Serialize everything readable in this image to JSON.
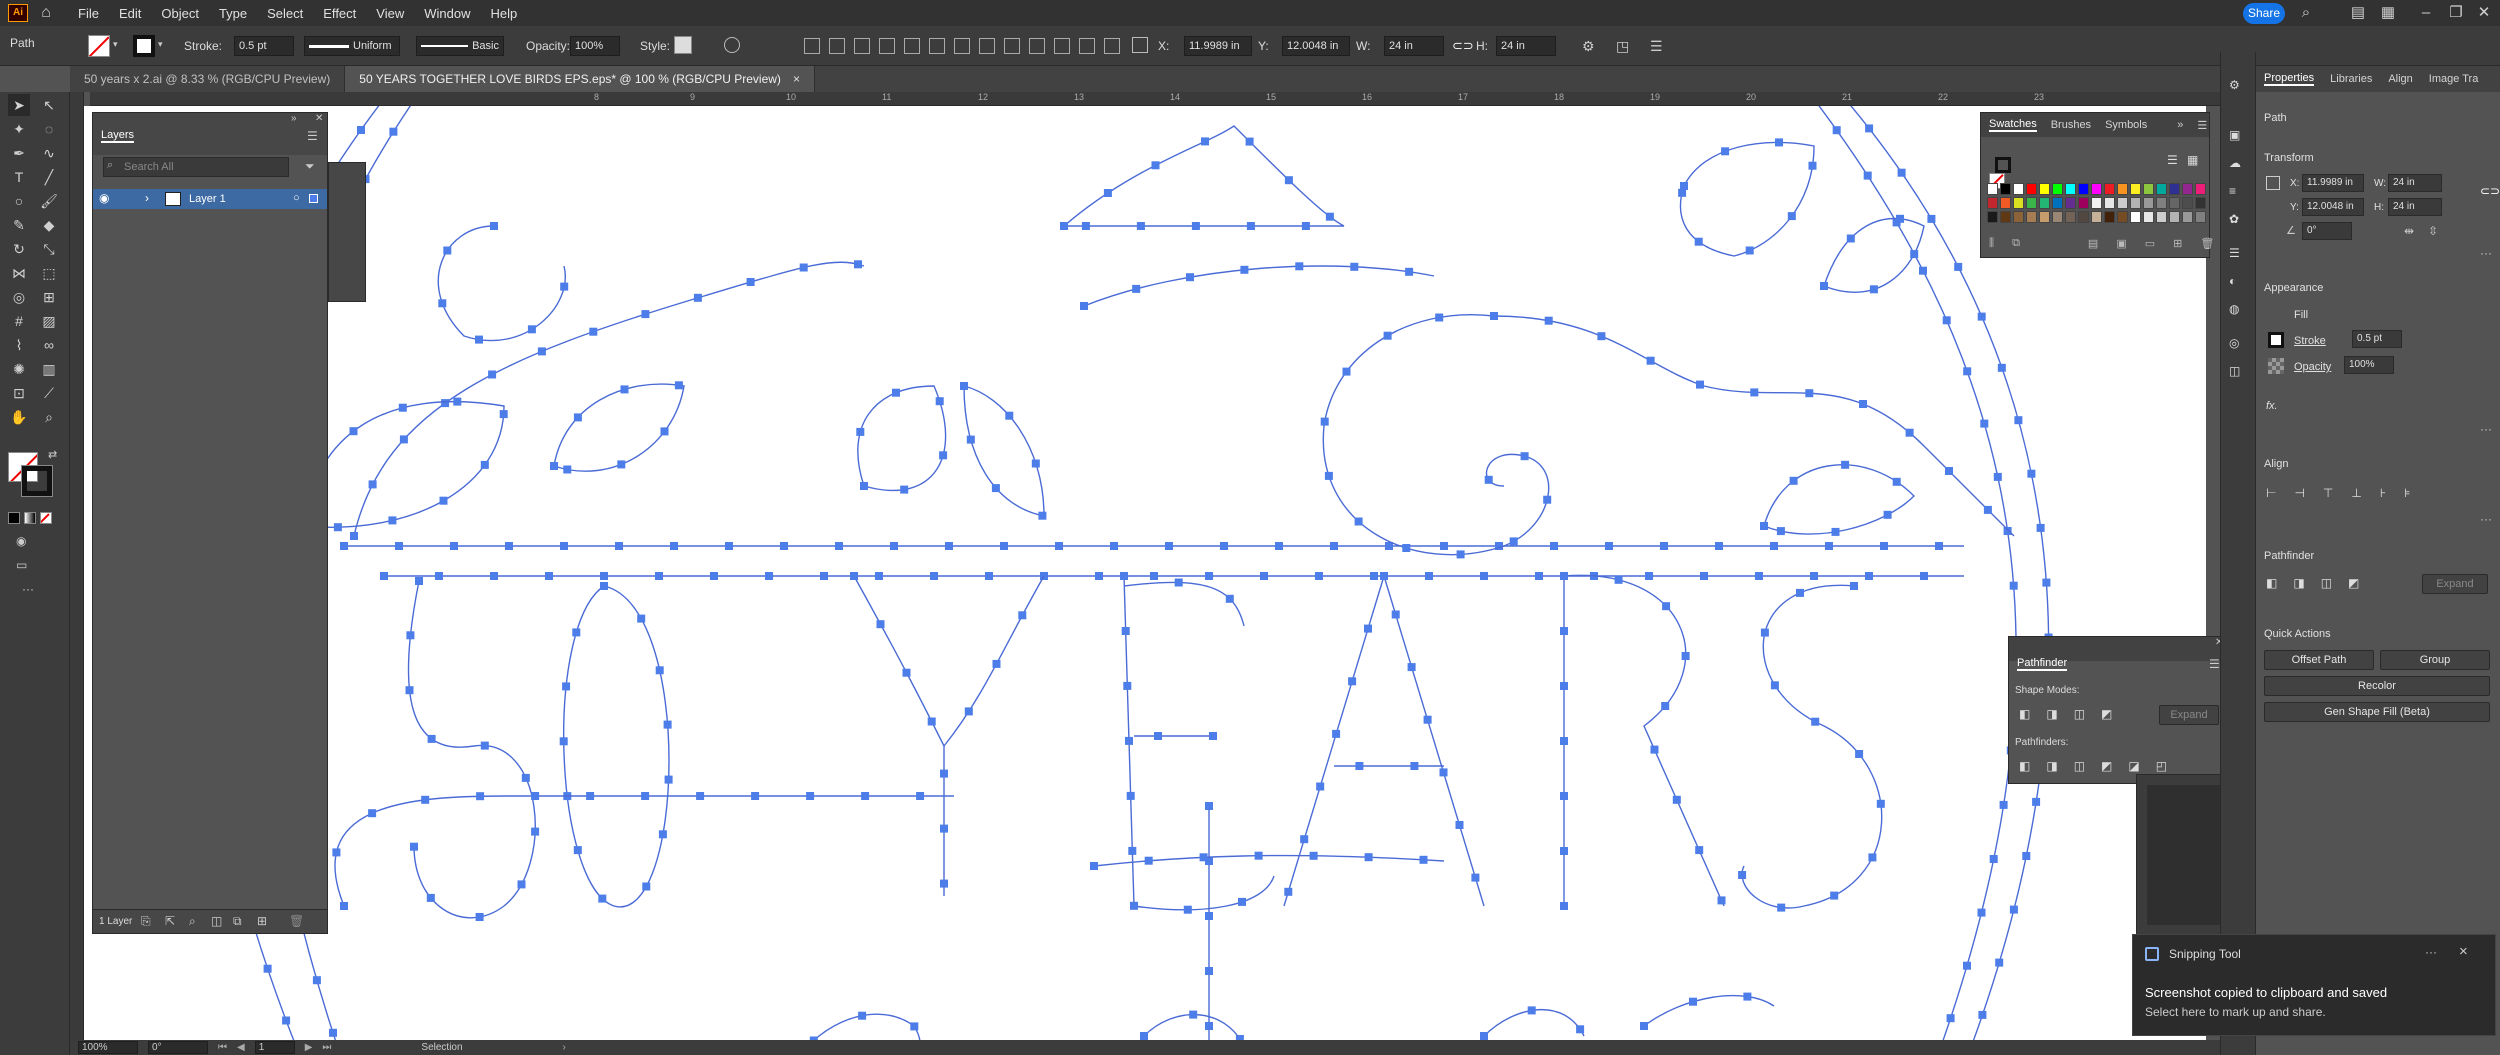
{
  "menubar": {
    "logo": "Ai",
    "menus": [
      "File",
      "Edit",
      "Object",
      "Type",
      "Select",
      "Effect",
      "View",
      "Window",
      "Help"
    ],
    "share_label": "Share"
  },
  "control": {
    "selection_type": "Path",
    "stroke_label": "Stroke:",
    "stroke_value": "0.5 pt",
    "uniform_label": "Uniform",
    "basic_label": "Basic",
    "opacity_label": "Opacity:",
    "opacity_value": "100%",
    "style_label": "Style:",
    "x_label": "X:",
    "x_value": "11.9989 in",
    "y_label": "Y:",
    "y_value": "12.0048 in",
    "w_label": "W:",
    "w_value": "24 in",
    "h_label": "H:",
    "h_value": "24 in"
  },
  "tabs": [
    {
      "label": "50 years x 2.ai @ 8.33 % (RGB/CPU Preview)"
    },
    {
      "label": "50 YEARS TOGETHER LOVE BIRDS EPS.eps* @ 100 % (RGB/CPU Preview)",
      "close": "×"
    }
  ],
  "ruler": {
    "ticks": [
      "8",
      "9",
      "10",
      "11",
      "12",
      "13",
      "14",
      "15",
      "16",
      "17",
      "18",
      "19",
      "20",
      "21",
      "22",
      "23"
    ]
  },
  "layers": {
    "title": "Layers",
    "search_placeholder": "Search All",
    "layer_name": "Layer 1",
    "footer": "1 Layer"
  },
  "swatches": {
    "tabs": [
      "Swatches",
      "Brushes",
      "Symbols"
    ],
    "colors": [
      "#ffffff",
      "#000000",
      "#ffffff",
      "#ff0000",
      "#ffff00",
      "#00ff00",
      "#00ffff",
      "#0000ff",
      "#ff00ff",
      "#ed1c24",
      "#f7931e",
      "#fcee21",
      "#8cc63f",
      "#00a99d",
      "#2e3192",
      "#93278f",
      "#ed1e79",
      "#c1272d",
      "#f15a24",
      "#d9e021",
      "#39b54a",
      "#22b573",
      "#0071bc",
      "#662d91",
      "#9e005d",
      "#f2f2f2",
      "#e6e6e6",
      "#cccccc",
      "#b3b3b3",
      "#999999",
      "#808080",
      "#666666",
      "#4d4d4d",
      "#333333",
      "#1a1a1a",
      "#603813",
      "#8c6239",
      "#a67c52",
      "#c69c6d",
      "#998675",
      "#736357",
      "#534741",
      "#c7b299",
      "#42210b",
      "#754c24",
      "#ffffff",
      "#e6e6e6",
      "#cccccc",
      "#b3b3b3",
      "#999999",
      "#808080"
    ]
  },
  "pathfinder": {
    "title": "Pathfinder",
    "shape_modes": "Shape Modes:",
    "pathfinders": "Pathfinders:",
    "expand": "Expand"
  },
  "properties": {
    "tabs": [
      "Properties",
      "Libraries",
      "Align",
      "Image Tra"
    ],
    "path": "Path",
    "transform": "Transform",
    "x_label": "X:",
    "x_value": "11.9989 in",
    "y_label": "Y:",
    "y_value": "12.0048 in",
    "w_label": "W:",
    "w_value": "24 in",
    "h_label": "H:",
    "h_value": "24 in",
    "angle_value": "0°",
    "appearance": "Appearance",
    "fill": "Fill",
    "stroke": "Stroke",
    "stroke_value": "0.5 pt",
    "opacity": "Opacity",
    "opacity_value": "100%",
    "fx": "fx.",
    "align": "Align",
    "pathfinder": "Pathfinder",
    "expand": "Expand",
    "quick_actions": "Quick Actions",
    "offset_path": "Offset Path",
    "group": "Group",
    "recolor": "Recolor",
    "gen_shape_fill": "Gen Shape Fill (Beta)"
  },
  "snip": {
    "app": "Snipping Tool",
    "title": "Screenshot copied to clipboard and saved",
    "body": "Select here to mark up and share.",
    "more": "···",
    "close": "×"
  },
  "status": {
    "zoom": "100%",
    "angle": "0°",
    "artboard": "1",
    "tool": "Selection"
  },
  "artwork": {
    "stroke_color": "#4a6bd6",
    "anchor_color": "#4d7de8"
  }
}
